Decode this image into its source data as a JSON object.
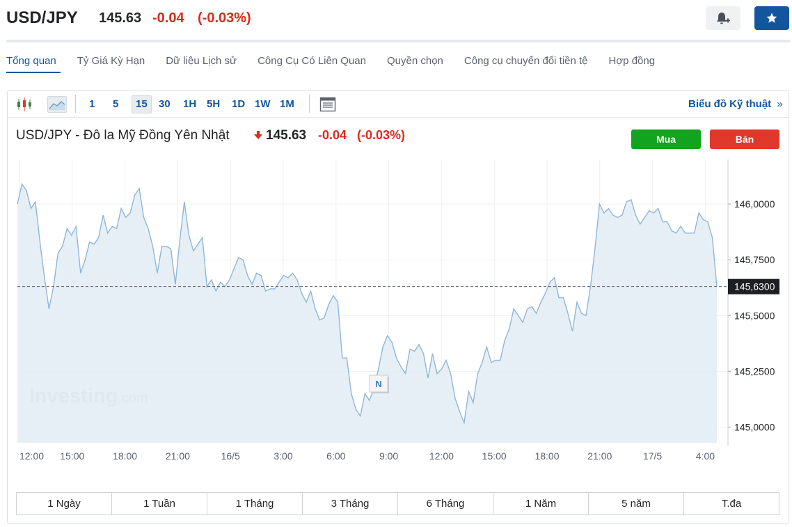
{
  "header": {
    "symbol": "USD/JPY",
    "last": "145.63",
    "change": "-0.04",
    "change_pct": "(-0.03%)",
    "bell_icon": "bell-plus-icon",
    "star_icon": "star-icon"
  },
  "tabs": [
    {
      "label": "Tổng quan",
      "active": true
    },
    {
      "label": "Tỷ Giá Kỳ Hạn"
    },
    {
      "label": "Dữ liệu Lịch sử"
    },
    {
      "label": "Công Cụ Có Liên Quan"
    },
    {
      "label": "Quyền chọn"
    },
    {
      "label": "Công cụ chuyển đổi tiền tệ"
    },
    {
      "label": "Hợp đồng"
    }
  ],
  "toolbar": {
    "candle_icon": "candlestick-chart-icon",
    "area_icon": "area-chart-icon",
    "timeframes": [
      "1",
      "5",
      "15",
      "30",
      "1H",
      "5H",
      "1D",
      "1W",
      "1M"
    ],
    "selected_timeframe": "15",
    "layout_icon": "chart-settings-icon",
    "technical_link": "Biểu đồ Kỹ thuật",
    "technical_chevron": "»"
  },
  "chart_header": {
    "title": "USD/JPY - Đô la Mỹ Đồng Yên Nhật",
    "price": "145.63",
    "change": "-0.04",
    "change_pct": "(-0.03%)",
    "buy_label": "Mua",
    "sell_label": "Bán"
  },
  "watermark": {
    "main": "Investing",
    "suffix": ".com"
  },
  "news_marker": "N",
  "chart_data": {
    "type": "area",
    "x_ticks": [
      "12:00",
      "15:00",
      "18:00",
      "21:00",
      "16/5",
      "3:00",
      "6:00",
      "9:00",
      "12:00",
      "15:00",
      "18:00",
      "21:00",
      "17/5",
      "4:00"
    ],
    "y_ticks": [
      "146,0000",
      "145,7500",
      "145,5000",
      "145,2500",
      "145,0000"
    ],
    "y_tick_values": [
      146.0,
      145.75,
      145.5,
      145.25,
      145.0
    ],
    "ylim": [
      144.93,
      146.2
    ],
    "current_price_label": "145,6300",
    "current_price": 145.63,
    "series": [
      {
        "values": [
          146.0,
          146.09,
          146.06,
          145.98,
          146.01,
          145.83,
          145.67,
          145.53,
          145.63,
          145.78,
          145.81,
          145.89,
          145.86,
          145.9,
          145.69,
          145.75,
          145.83,
          145.82,
          145.85,
          145.95,
          145.87,
          145.9,
          145.89,
          145.98,
          145.94,
          145.96,
          146.04,
          146.07,
          145.94,
          145.89,
          145.81,
          145.69,
          145.81,
          145.81,
          145.8,
          145.64,
          145.84,
          146.01,
          145.86,
          145.79,
          145.82,
          145.85,
          145.63,
          145.66,
          145.61,
          145.65,
          145.63,
          145.66,
          145.71,
          145.76,
          145.75,
          145.68,
          145.64,
          145.69,
          145.68,
          145.61,
          145.62,
          145.62,
          145.65,
          145.68,
          145.67,
          145.69,
          145.66,
          145.6,
          145.56,
          145.61,
          145.53,
          145.48,
          145.49,
          145.55,
          145.59,
          145.56,
          145.31,
          145.31,
          145.15,
          145.08,
          145.05,
          145.15,
          145.12,
          145.17,
          145.26,
          145.36,
          145.41,
          145.38,
          145.31,
          145.27,
          145.24,
          145.35,
          145.34,
          145.37,
          145.33,
          145.22,
          145.33,
          145.24,
          145.26,
          145.3,
          145.24,
          145.13,
          145.07,
          145.02,
          145.16,
          145.11,
          145.24,
          145.29,
          145.36,
          145.29,
          145.3,
          145.3,
          145.39,
          145.44,
          145.53,
          145.5,
          145.47,
          145.53,
          145.54,
          145.51,
          145.56,
          145.6,
          145.65,
          145.67,
          145.58,
          145.58,
          145.51,
          145.43,
          145.56,
          145.51,
          145.5,
          145.63,
          145.8,
          146.0,
          145.96,
          145.98,
          145.95,
          145.94,
          145.95,
          146.01,
          146.02,
          145.95,
          145.91,
          145.94,
          145.97,
          145.96,
          145.98,
          145.92,
          145.92,
          145.88,
          145.87,
          145.9,
          145.87,
          145.87,
          145.87,
          145.96,
          145.93,
          145.92,
          145.85,
          145.63
        ]
      }
    ],
    "grid": true
  },
  "periods": [
    "1 Ngày",
    "1 Tuần",
    "1 Tháng",
    "3 Tháng",
    "6 Tháng",
    "1 Năm",
    "5 năm",
    "T.đa"
  ]
}
